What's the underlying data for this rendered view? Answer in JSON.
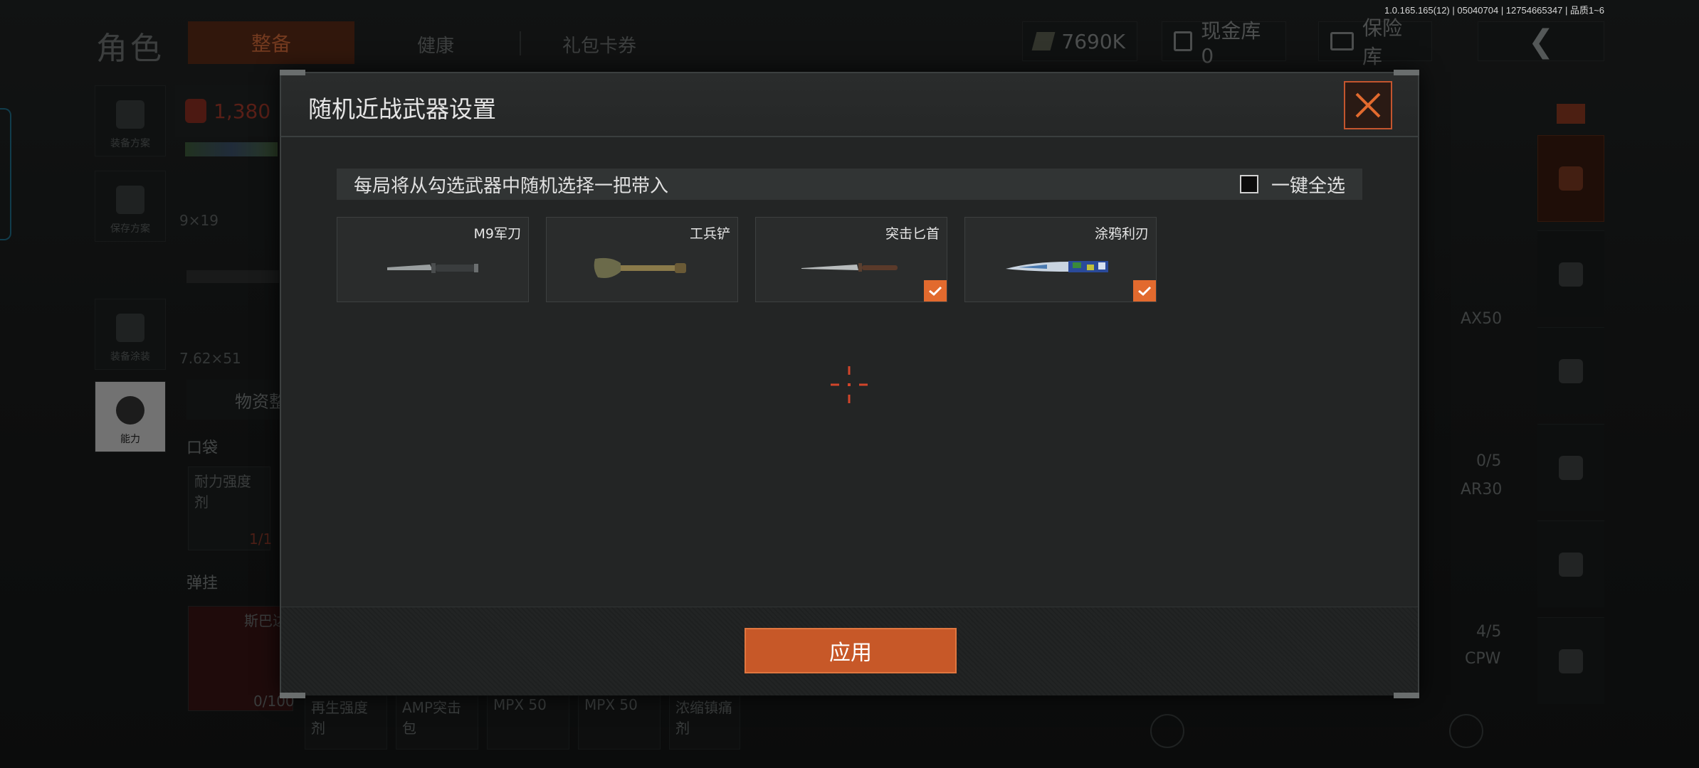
{
  "version_info": "1.0.165.165(12) | 05040704 | 12754665347 | 品质1~6",
  "background": {
    "section_title": "角色",
    "tabs": [
      {
        "label": "整备",
        "active": true
      },
      {
        "label": "健康",
        "active": false
      },
      {
        "label": "礼包卡券",
        "active": false
      }
    ],
    "currency": "7690K",
    "cash_vault": "现金库 0",
    "insurance_vault": "保险库",
    "left_menu": [
      "装备方案",
      "保存方案",
      "装备涂装",
      "能力"
    ],
    "stat_value": "1,380",
    "calibers": [
      "9×19",
      "7.62×51"
    ],
    "supply_tab": "物资整",
    "pocket_label": "口袋",
    "pocket_item": "耐力强度剂",
    "pocket_count": "1/1",
    "ammo_label": "弹挂",
    "ammo_item": "斯巴达",
    "ammo_count": "0/100",
    "bottom_items": [
      "再生强度剂",
      "AMP突击包",
      "MPX 50",
      "MPX 50",
      "浓缩镇痛剂"
    ],
    "side_labels": [
      "AX50",
      "AR30",
      "CPW"
    ],
    "side_counts": [
      "0/5",
      "4/5"
    ]
  },
  "modal": {
    "title": "随机近战武器设置",
    "info": "每局将从勾选武器中随机选择一把带入",
    "select_all": {
      "label": "一键全选",
      "checked": false
    },
    "weapons": [
      {
        "name": "M9军刀",
        "checked": false
      },
      {
        "name": "工兵铲",
        "checked": false
      },
      {
        "name": "突击匕首",
        "checked": true
      },
      {
        "name": "涂鸦利刃",
        "checked": true
      }
    ],
    "apply_label": "应用"
  },
  "colors": {
    "accent": "#e26a2e",
    "accent_dark": "#c75828",
    "panel": "#232525"
  }
}
